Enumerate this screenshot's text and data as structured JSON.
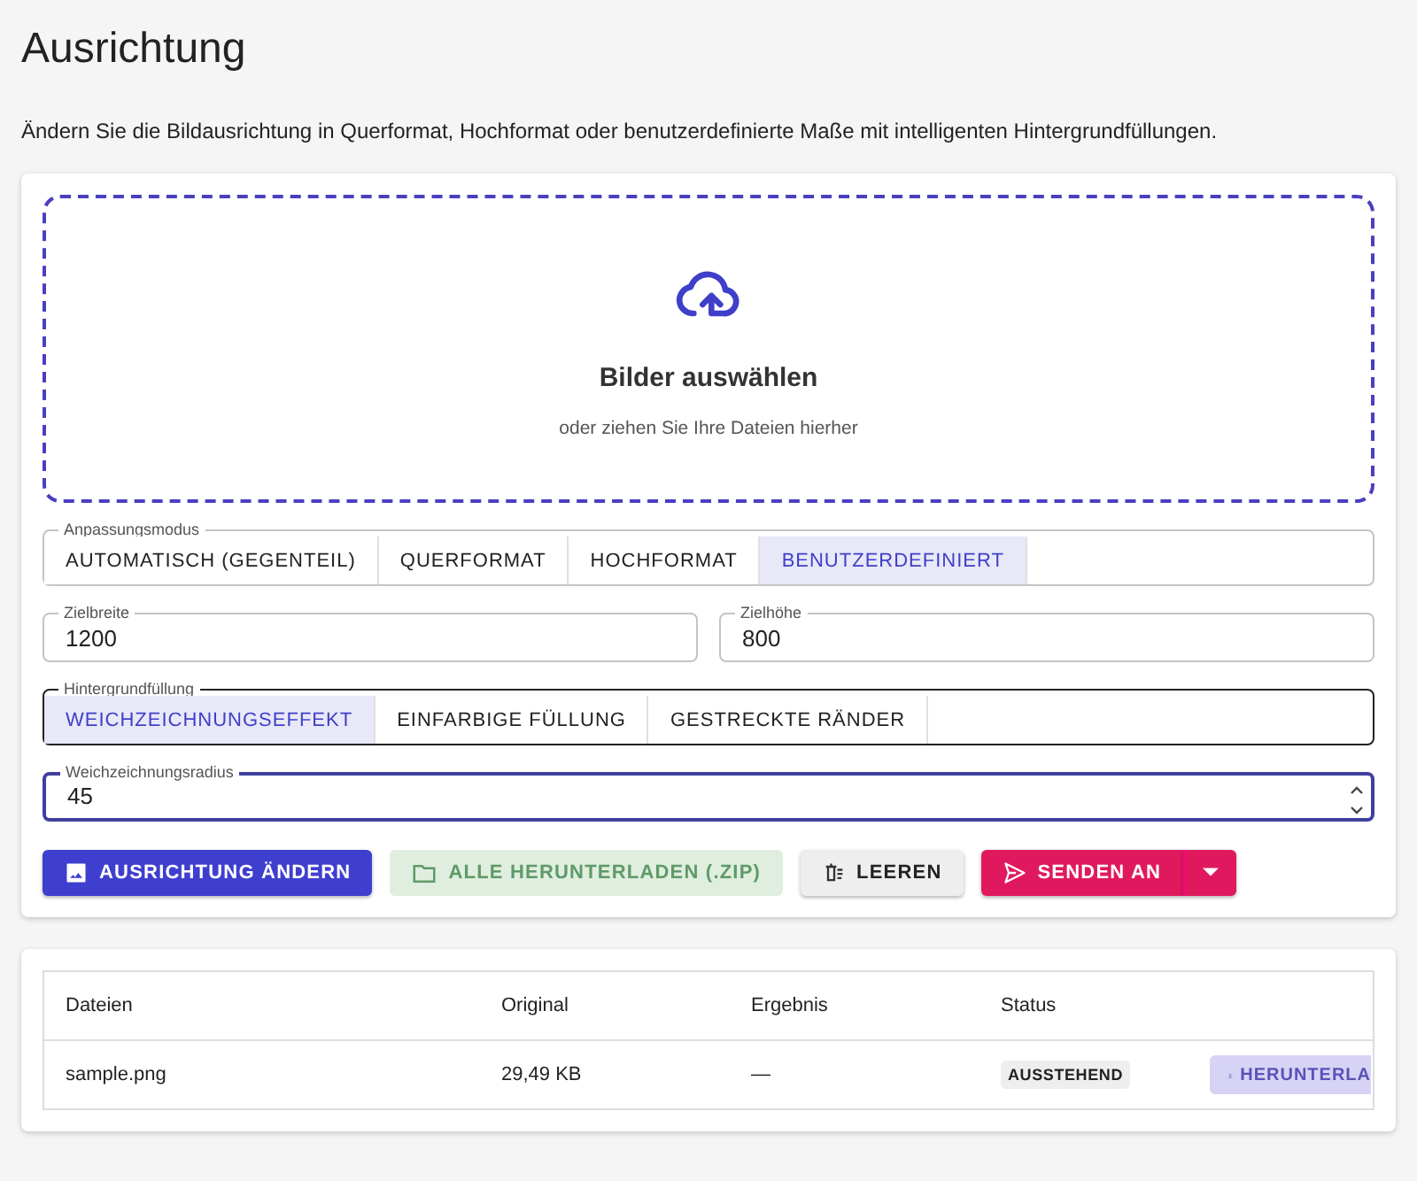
{
  "title": "Ausrichtung",
  "description": "Ändern Sie die Bildausrichtung in Querformat, Hochformat oder benutzerdefinierte Maße mit intelligenten Hintergrundfüllungen.",
  "dropzone": {
    "title": "Bilder auswählen",
    "hint": "oder ziehen Sie Ihre Dateien hierher"
  },
  "mode_group": {
    "label": "Anpassungsmodus",
    "focused": false,
    "options": [
      {
        "label": "AUTOMATISCH (GEGENTEIL)",
        "selected": false
      },
      {
        "label": "QUERFORMAT",
        "selected": false
      },
      {
        "label": "HOCHFORMAT",
        "selected": false
      },
      {
        "label": "BENUTZERDEFINIERT",
        "selected": true
      }
    ]
  },
  "size_fields": [
    {
      "label": "Zielbreite",
      "value": "1200",
      "focused": false
    },
    {
      "label": "Zielhöhe",
      "value": "800",
      "focused": false
    }
  ],
  "fill_group": {
    "label": "Hintergrundfüllung",
    "focused": true,
    "options": [
      {
        "label": "WEICHZEICHNUNGSEFFEKT",
        "selected": true
      },
      {
        "label": "EINFARBIGE FÜLLUNG",
        "selected": false
      },
      {
        "label": "GESTRECKTE RÄNDER",
        "selected": false
      }
    ]
  },
  "radius_field": {
    "label": "Weichzeichnungsradius",
    "value": "45",
    "focused": true
  },
  "buttons": [
    {
      "kind": "primary",
      "label": "AUSRICHTUNG ÄNDERN",
      "disabled": false
    },
    {
      "kind": "success",
      "label": "ALLE HERUNTERLADEN (.ZIP)",
      "disabled": true
    },
    {
      "kind": "neutral",
      "label": "LEEREN",
      "disabled": false
    },
    {
      "kind": "send",
      "label": "SENDEN AN",
      "disabled": false
    }
  ],
  "table": {
    "columns": [
      "Dateien",
      "Original",
      "Ergebnis",
      "Status"
    ],
    "rows": [
      {
        "file": "sample.png",
        "original": "29,49 KB",
        "result": "—",
        "status": "AUSSTEHEND",
        "action": "HERUNTERLA",
        "action_disabled": true
      }
    ]
  }
}
